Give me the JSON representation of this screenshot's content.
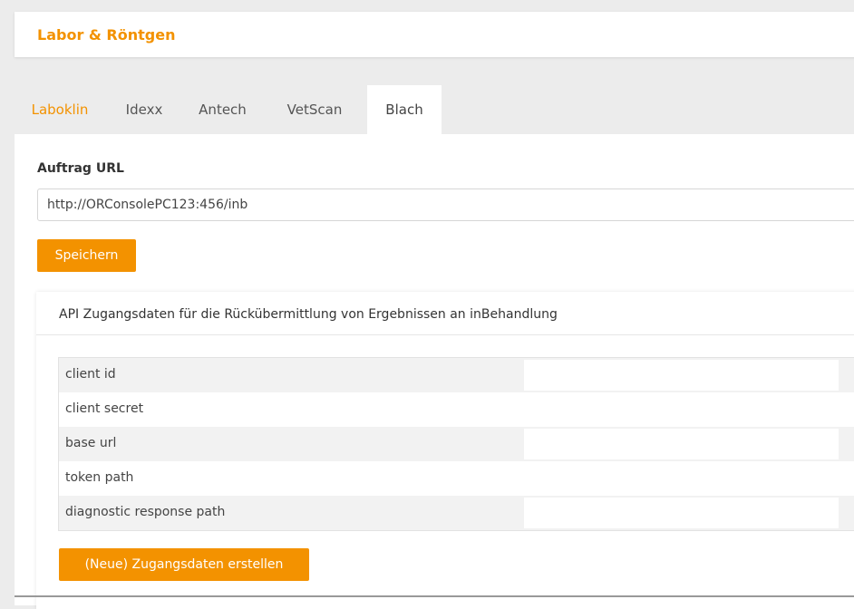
{
  "header": {
    "title": "Labor & Röntgen"
  },
  "tabs": [
    {
      "label": "Laboklin"
    },
    {
      "label": "Idexx"
    },
    {
      "label": "Antech"
    },
    {
      "label": "VetScan"
    },
    {
      "label": "Blach"
    }
  ],
  "order": {
    "label": "Auftrag URL",
    "url_value": "http://ORConsolePC123:456/inb",
    "save_label": "Speichern"
  },
  "api": {
    "heading": "API Zugangsdaten für die Rückübermittlung von Ergebnissen an inBehandlung",
    "rows": [
      {
        "label": "client id",
        "value": ""
      },
      {
        "label": "client secret",
        "value": ""
      },
      {
        "label": "base url",
        "value": ""
      },
      {
        "label": "token path",
        "value": ""
      },
      {
        "label": "diagnostic response path",
        "value": ""
      }
    ],
    "create_label": "(Neue) Zugangsdaten erstellen"
  },
  "colors": {
    "accent": "#f39200",
    "background": "#ececec",
    "panel": "#ffffff"
  }
}
